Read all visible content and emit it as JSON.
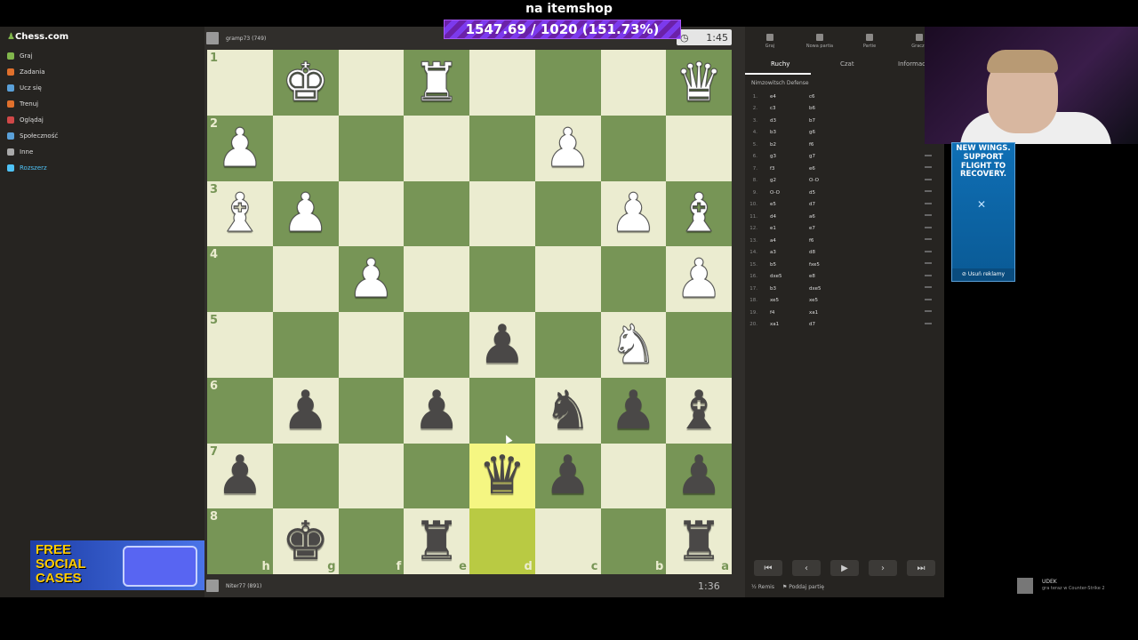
{
  "banner": {
    "title": "na itemshop",
    "progress_text": "1547.69 / 1020 (151.73%)",
    "progress_percent": 151.73
  },
  "sidebar": {
    "logo": "Chess.com",
    "items": [
      {
        "label": "Graj",
        "color": "#81b64c"
      },
      {
        "label": "Zadania",
        "color": "#e0702c"
      },
      {
        "label": "Ucz się",
        "color": "#5aa0d8"
      },
      {
        "label": "Trenuj",
        "color": "#e0702c"
      },
      {
        "label": "Oglądaj",
        "color": "#d04848"
      },
      {
        "label": "Społeczność",
        "color": "#5aa0d8"
      },
      {
        "label": "Inne",
        "color": "#aaaaaa"
      },
      {
        "label": "Rozszerz",
        "color": "#4fc3f7"
      }
    ]
  },
  "players": {
    "top": {
      "name": "gramp73 (749)",
      "clock": "1:45"
    },
    "bottom": {
      "name": "Niter77 (891)",
      "clock": "1:36"
    }
  },
  "board": {
    "rank_labels": [
      "1",
      "2",
      "3",
      "4",
      "5",
      "6",
      "7",
      "8"
    ],
    "file_labels": [
      "h",
      "g",
      "f",
      "e",
      "d",
      "c",
      "b",
      "a"
    ],
    "highlight": [
      [
        6,
        4
      ],
      [
        7,
        4
      ]
    ],
    "rows": [
      [
        "",
        "wK",
        "",
        "wR",
        "",
        "",
        "",
        "wQ"
      ],
      [
        "wP",
        "",
        "",
        "",
        "",
        "wP",
        "",
        ""
      ],
      [
        "wB",
        "wP",
        "",
        "",
        "",
        "",
        "wP",
        "wB"
      ],
      [
        "",
        "",
        "wP",
        "",
        "",
        "",
        "",
        "wP"
      ],
      [
        "",
        "",
        "",
        "",
        "bP",
        "",
        "wN",
        ""
      ],
      [
        "",
        "bP",
        "",
        "bP",
        "",
        "bN",
        "bP",
        "bB"
      ],
      [
        "bP",
        "",
        "",
        "",
        "bQ",
        "bP",
        "",
        "bP"
      ],
      [
        "",
        "bK",
        "",
        "bR",
        "",
        "",
        "",
        "bR"
      ]
    ]
  },
  "panel": {
    "top_tabs": [
      "Graj",
      "Nowa partia",
      "Partie",
      "Gracze"
    ],
    "sub_tabs": [
      "Ruchy",
      "Czat",
      "Informacje"
    ],
    "opening": "Nimzowitsch Defense",
    "moves": [
      {
        "n": "1.",
        "w": "e4",
        "b": "c6"
      },
      {
        "n": "2.",
        "w": "c3",
        "b": "b6"
      },
      {
        "n": "3.",
        "w": "d3",
        "b": "b7"
      },
      {
        "n": "4.",
        "w": "b3",
        "b": "g6"
      },
      {
        "n": "5.",
        "w": "b2",
        "b": "f6"
      },
      {
        "n": "6.",
        "w": "g3",
        "b": "g7"
      },
      {
        "n": "7.",
        "w": "f3",
        "b": "e6"
      },
      {
        "n": "8.",
        "w": "g2",
        "b": "O-O"
      },
      {
        "n": "9.",
        "w": "O-O",
        "b": "d5"
      },
      {
        "n": "10.",
        "w": "e5",
        "b": "d7"
      },
      {
        "n": "11.",
        "w": "d4",
        "b": "a6"
      },
      {
        "n": "12.",
        "w": "e1",
        "b": "e7"
      },
      {
        "n": "13.",
        "w": "a4",
        "b": "f6"
      },
      {
        "n": "14.",
        "w": "a3",
        "b": "d8"
      },
      {
        "n": "15.",
        "w": "b5",
        "b": "fxe5"
      },
      {
        "n": "16.",
        "w": "dxe5",
        "b": "e8"
      },
      {
        "n": "17.",
        "w": "b3",
        "b": "dxe5"
      },
      {
        "n": "18.",
        "w": "xe5",
        "b": "xe5"
      },
      {
        "n": "19.",
        "w": "f4",
        "b": "xa1"
      },
      {
        "n": "20.",
        "w": "xa1",
        "b": "d7"
      }
    ],
    "controls": [
      "⏮",
      "‹",
      "▶",
      "›",
      "⏭"
    ],
    "draw_label": "Remis",
    "resign_label": "Poddaj partię"
  },
  "ad": {
    "text": "NEW WINGS. SUPPORT FLIGHT TO RECOVERY.",
    "remove_label": "Usuń reklamy"
  },
  "overlay": {
    "social_text": "FREE SOCIAL CASES"
  },
  "notification": {
    "name": "UDEK",
    "line1": "gra teraz w",
    "line2": "Counter-Strike 2"
  }
}
